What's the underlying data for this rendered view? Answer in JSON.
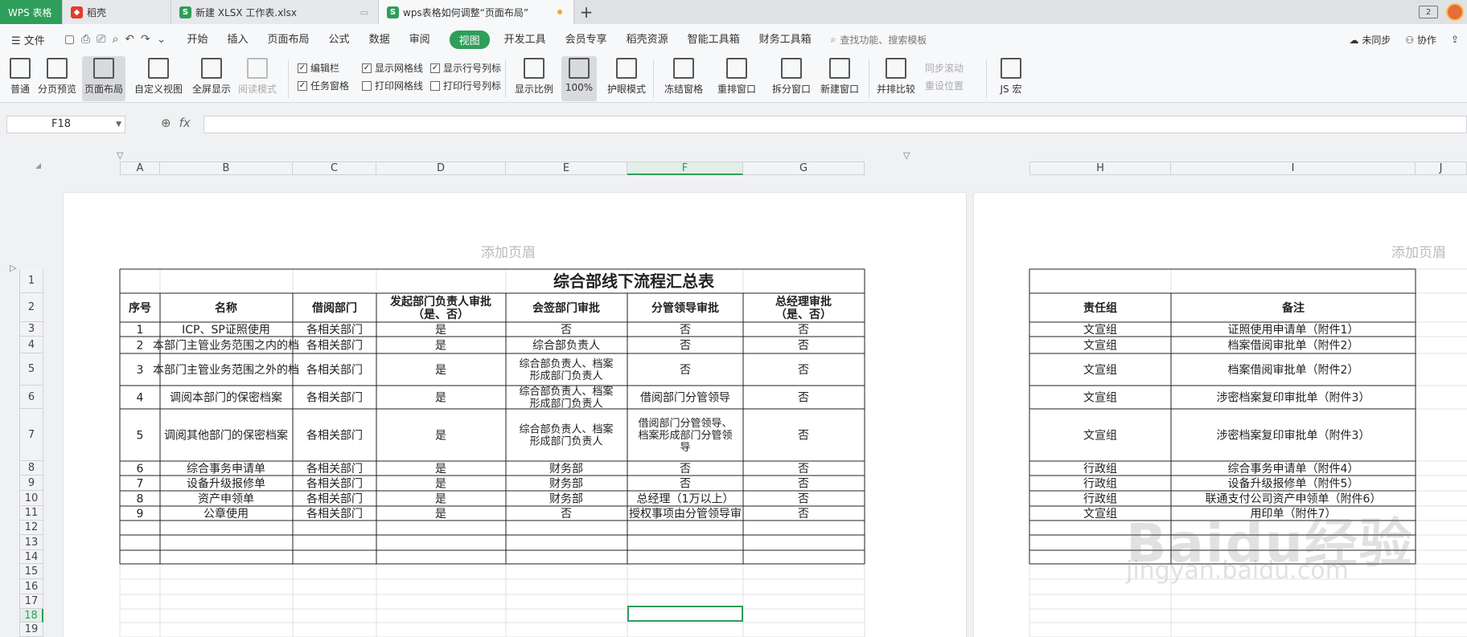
{
  "tabs": {
    "app_label": "WPS 表格",
    "items": [
      {
        "label": "稻壳"
      },
      {
        "label": "新建 XLSX 工作表.xlsx"
      },
      {
        "label": "wps表格如何调整“页面布局”"
      }
    ],
    "new_tab": "+",
    "restore_label": "2"
  },
  "menu": {
    "file": "文件",
    "items": [
      "开始",
      "插入",
      "页面布局",
      "公式",
      "数据",
      "审阅",
      "视图",
      "开发工具",
      "会员专享",
      "稻壳资源",
      "智能工具箱",
      "财务工具箱"
    ],
    "active": "视图",
    "search_placeholder": "查找功能、搜索模板",
    "right": [
      "未同步",
      "协作"
    ]
  },
  "ribbon": {
    "buttons": [
      {
        "label": "普通",
        "icon": "normal-view-icon"
      },
      {
        "label": "分页预览",
        "icon": "page-break-icon"
      },
      {
        "label": "页面布局",
        "icon": "page-layout-icon",
        "active": true
      },
      {
        "label": "自定义视图",
        "icon": "custom-view-icon"
      },
      {
        "label": "全屏显示",
        "icon": "fullscreen-icon"
      },
      {
        "label": "阅读模式",
        "icon": "reading-mode-icon",
        "dim": true
      },
      {
        "label": "显示比例",
        "icon": "zoom-icon"
      },
      {
        "label": "100%",
        "icon": "zoom-100-icon",
        "active": true
      },
      {
        "label": "护眼模式",
        "icon": "eye-icon"
      },
      {
        "label": "冻结窗格",
        "icon": "freeze-panes-icon"
      },
      {
        "label": "重排窗口",
        "icon": "arrange-windows-icon"
      },
      {
        "label": "拆分窗口",
        "icon": "split-window-icon"
      },
      {
        "label": "新建窗口",
        "icon": "new-window-icon"
      },
      {
        "label": "并排比较",
        "icon": "compare-icon"
      },
      {
        "label": "JS 宏",
        "icon": "js-macro-icon"
      }
    ],
    "checks": [
      {
        "label": "编辑栏",
        "checked": true
      },
      {
        "label": "显示网格线",
        "checked": true
      },
      {
        "label": "显示行号列标",
        "checked": true
      },
      {
        "label": "任务窗格",
        "checked": true
      },
      {
        "label": "打印网格线",
        "checked": false
      },
      {
        "label": "打印行号列标",
        "checked": false
      }
    ],
    "sync_scroll": "同步滚动",
    "reset_position": "重设位置"
  },
  "formula_bar": {
    "name_box": "F18",
    "fx": "fx",
    "formula": ""
  },
  "sheet": {
    "columns": [
      "A",
      "B",
      "C",
      "D",
      "E",
      "F",
      "G",
      "H",
      "I",
      "J"
    ],
    "selected_column": "F",
    "rows": [
      "1",
      "2",
      "3",
      "4",
      "5",
      "6",
      "7",
      "8",
      "9",
      "10",
      "11",
      "12",
      "13",
      "14",
      "15",
      "16",
      "17",
      "18",
      "19"
    ],
    "selected_row": "18",
    "header_placeholder": "添加页眉",
    "title": "综合部线下流程汇总表",
    "table_headers": [
      "序号",
      "名称",
      "借阅部门",
      "发起部门负责人审批\n（是、否）",
      "会签部门审批",
      "分管领导审批",
      "总经理审批\n（是、否）",
      "责任组",
      "备注"
    ],
    "table_rows": [
      [
        "1",
        "ICP、SP证照使用",
        "各相关部门",
        "是",
        "否",
        "否",
        "否",
        "文宣组",
        "证照使用申请单（附件1）"
      ],
      [
        "2",
        "本部门主管业务范围之内的档",
        "各相关部门",
        "是",
        "综合部负责人",
        "否",
        "否",
        "文宣组",
        "档案借阅审批单（附件2）"
      ],
      [
        "3",
        "本部门主管业务范围之外的档",
        "各相关部门",
        "是",
        "综合部负责人、档案\n形成部门负责人",
        "否",
        "否",
        "文宣组",
        "档案借阅审批单（附件2）"
      ],
      [
        "4",
        "调阅本部门的保密档案",
        "各相关部门",
        "是",
        "综合部负责人、档案\n形成部门负责人",
        "借阅部门分管领导",
        "否",
        "文宣组",
        "涉密档案复印审批单（附件3）"
      ],
      [
        "5",
        "调阅其他部门的保密档案",
        "各相关部门",
        "是",
        "综合部负责人、档案\n形成部门负责人",
        "借阅部门分管领导、\n档案形成部门分管领\n导",
        "否",
        "文宣组",
        "涉密档案复印审批单（附件3）"
      ],
      [
        "6",
        "综合事务申请单",
        "各相关部门",
        "是",
        "财务部",
        "否",
        "否",
        "行政组",
        "综合事务申请单（附件4）"
      ],
      [
        "7",
        "设备升级报修单",
        "各相关部门",
        "是",
        "财务部",
        "否",
        "否",
        "行政组",
        "设备升级报修单（附件5）"
      ],
      [
        "8",
        "资产申领单",
        "各相关部门",
        "是",
        "财务部",
        "总经理（1万以上）",
        "否",
        "行政组",
        "联通支付公司资产申领单（附件6）"
      ],
      [
        "9",
        "公章使用",
        "各相关部门",
        "是",
        "否",
        "授权事项由分管领导审",
        "否",
        "文宣组",
        "用印单（附件7）"
      ]
    ]
  },
  "watermark": {
    "main": "Baidu经验",
    "sub": "jingyan.baidu.com"
  }
}
